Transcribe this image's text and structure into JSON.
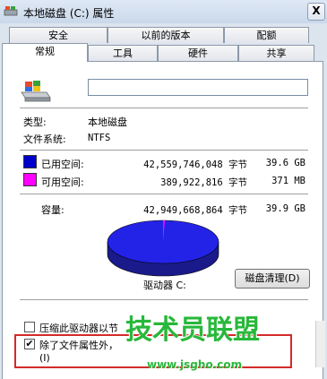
{
  "window": {
    "title": "本地磁盘 (C:) 属性",
    "close_glyph": "X"
  },
  "tabs_row1": [
    "安全",
    "以前的版本",
    "配额"
  ],
  "tabs_row2": [
    "常规",
    "工具",
    "硬件",
    "共享"
  ],
  "general": {
    "name_value": "",
    "type_label": "类型:",
    "type_value": "本地磁盘",
    "fs_label": "文件系统:",
    "fs_value": "NTFS",
    "used": {
      "label": "已用空间:",
      "bytes": "42,559,746,048 字节",
      "size": "39.6 GB",
      "color": "#0000cc"
    },
    "free": {
      "label": "可用空间:",
      "bytes": "389,922,816 字节",
      "size": "371 MB",
      "color": "#ff00ff"
    },
    "capacity": {
      "label": "容量:",
      "bytes": "42,949,668,864 字节",
      "size": "39.9 GB"
    },
    "drive_label": "驱动器 C:",
    "cleanup_button": "磁盘清理(D)",
    "compress_label": "压缩此驱动器以节",
    "compress_checked": false,
    "index_label_line1": "除了文件属性外，",
    "index_label_line2": "(I)",
    "index_checked": true,
    "check_glyph": "✔"
  },
  "watermark": {
    "name": "技术员联盟",
    "url": "www.jsgho.com"
  },
  "icons": {
    "drive": "drive-icon",
    "title": "drive-icon"
  }
}
